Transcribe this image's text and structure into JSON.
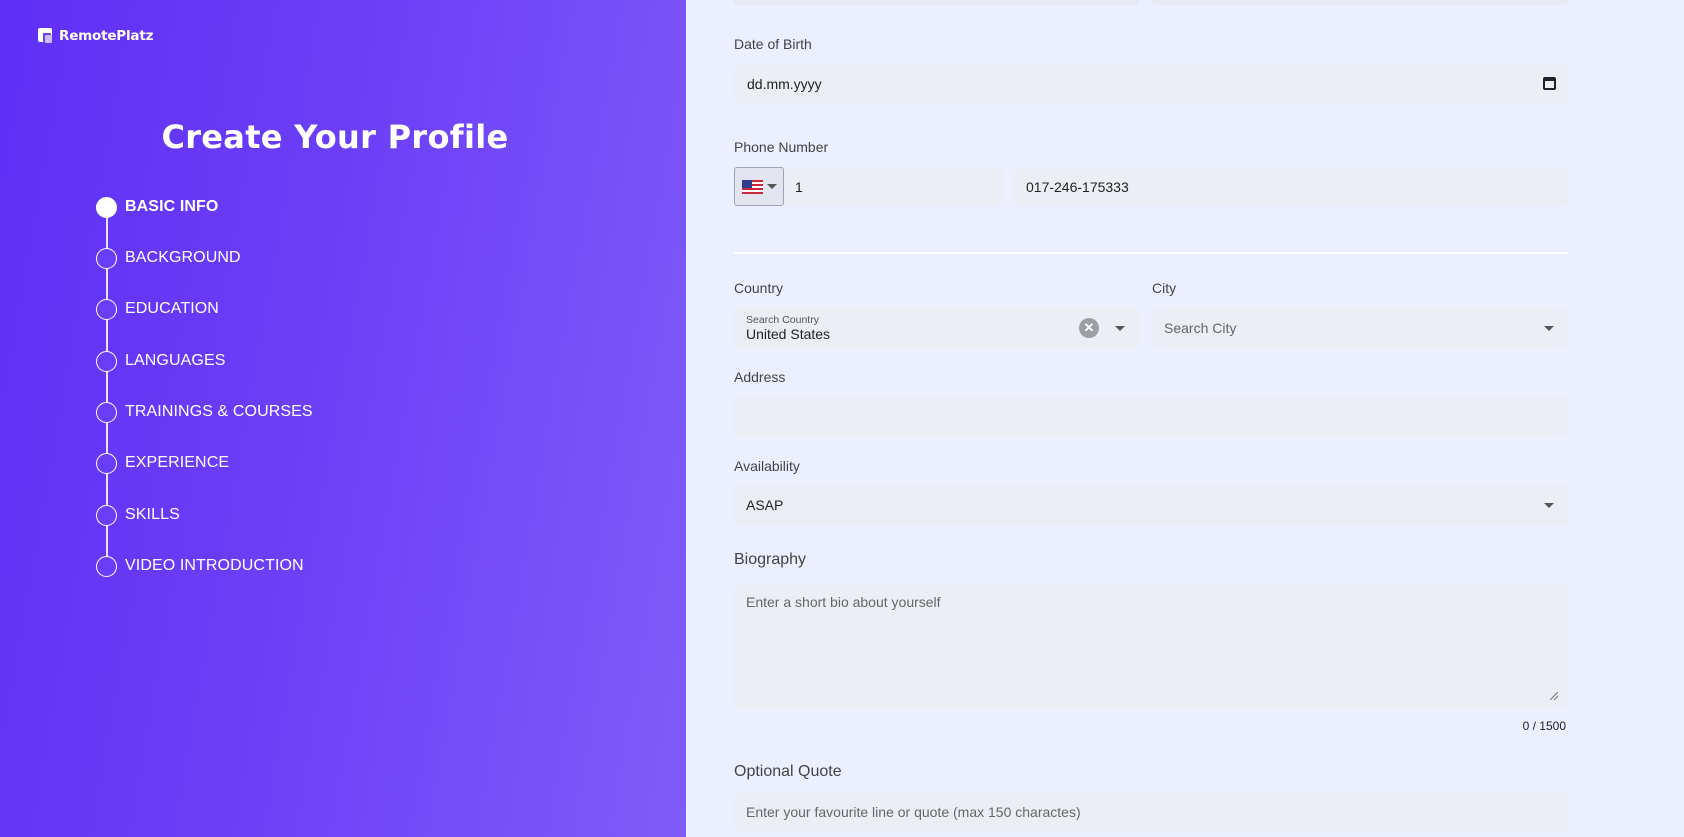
{
  "brand": {
    "name": "RemotePlatz"
  },
  "sidebar": {
    "title": "Create Your Profile",
    "steps": [
      {
        "label": "BASIC INFO",
        "active": true
      },
      {
        "label": "BACKGROUND",
        "active": false
      },
      {
        "label": "EDUCATION",
        "active": false
      },
      {
        "label": "LANGUAGES",
        "active": false
      },
      {
        "label": "TRAININGS & COURSES",
        "active": false
      },
      {
        "label": "EXPERIENCE",
        "active": false
      },
      {
        "label": "SKILLS",
        "active": false
      },
      {
        "label": "VIDEO INTRODUCTION",
        "active": false
      }
    ]
  },
  "form": {
    "dob": {
      "label": "Date of Birth",
      "value": "dd.mm.yyyy",
      "icon": "calendar-icon"
    },
    "phone": {
      "label": "Phone Number",
      "flag": "us-flag-icon",
      "code": "1",
      "number": "017-246-175333"
    },
    "country": {
      "label": "Country",
      "floating_label": "Search Country",
      "value": "United States"
    },
    "city": {
      "label": "City",
      "placeholder": "Search City"
    },
    "address": {
      "label": "Address",
      "value": ""
    },
    "availability": {
      "label": "Availability",
      "value": "ASAP"
    },
    "biography": {
      "label": "Biography",
      "placeholder": "Enter a short bio about yourself",
      "counter": "0 / 1500"
    },
    "quote": {
      "label": "Optional Quote",
      "placeholder": "Enter your favourite line or quote (max 150 charactes)"
    }
  },
  "colors": {
    "accent": "#6a3df7",
    "panel_bg": "#ecefff",
    "field_bg": "#eceef5"
  }
}
